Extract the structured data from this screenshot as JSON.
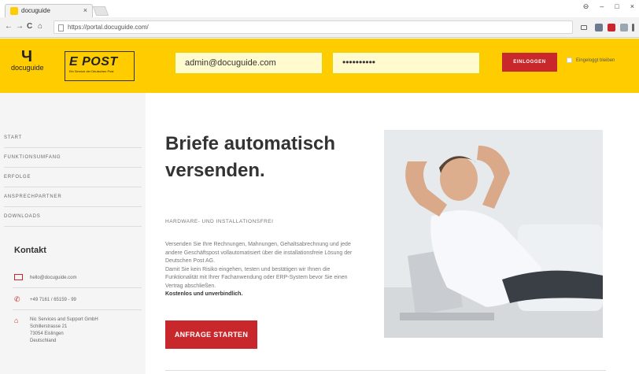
{
  "browser": {
    "tab_title": "docuguide",
    "tab_close": "×",
    "url": "https://portal.docuguide.com/",
    "nav": {
      "back": "←",
      "forward": "→",
      "reload": "C",
      "home": "⌂"
    },
    "window_controls": {
      "account": "⊖",
      "minimize": "–",
      "maximize": "□",
      "close": "×"
    }
  },
  "header": {
    "logo_mark": "Ч",
    "logo_text": "docuguide",
    "epost_title": "E POST",
    "epost_subtitle": "Ein Service der Deutschen Post",
    "email_value": "admin@docuguide.com",
    "password_value": "••••••••••",
    "login_label": "EINLOGGEN",
    "remember_label": "Eingeloggt bleiben"
  },
  "sidebar": {
    "items": [
      {
        "label": "START"
      },
      {
        "label": "FUNKTIONSUMFANG"
      },
      {
        "label": "ERFOLGE"
      },
      {
        "label": "ANSPRECHPARTNER"
      },
      {
        "label": "DOWNLOADS"
      }
    ],
    "contact_title": "Kontakt",
    "email": "hello@docuguide.com",
    "phone": "+49 7161 / 65159 - 99",
    "address": [
      "Nic Services and Support GmbH",
      "Schillerstrasse 21",
      "73054 Eislingen",
      "Deutschland"
    ]
  },
  "hero": {
    "headline": "Briefe automatisch versenden.",
    "subline": "HARDWARE- UND INSTALLATIONSFREI",
    "paragraph1": "Versenden Sie Ihre Rechnungen, Mahnungen, Gehaltsabrechnung und jede andere Geschäftspost vollautomatisiert über die installationsfreie Lösung der Deutschen Post AG.",
    "paragraph2": "Damit Sie kein Risiko eingehen, testen und bestätigen wir Ihnen die Funktionalität mit Ihrer Fachanwendung oder ERP-System bevor Sie einen Vertrag abschließen.",
    "paragraph3": "Kostenlos und unverbindlich.",
    "cta_label": "ANFRAGE STARTEN"
  },
  "colors": {
    "brand_yellow": "#ffcc00",
    "accent_red": "#c8282c"
  }
}
